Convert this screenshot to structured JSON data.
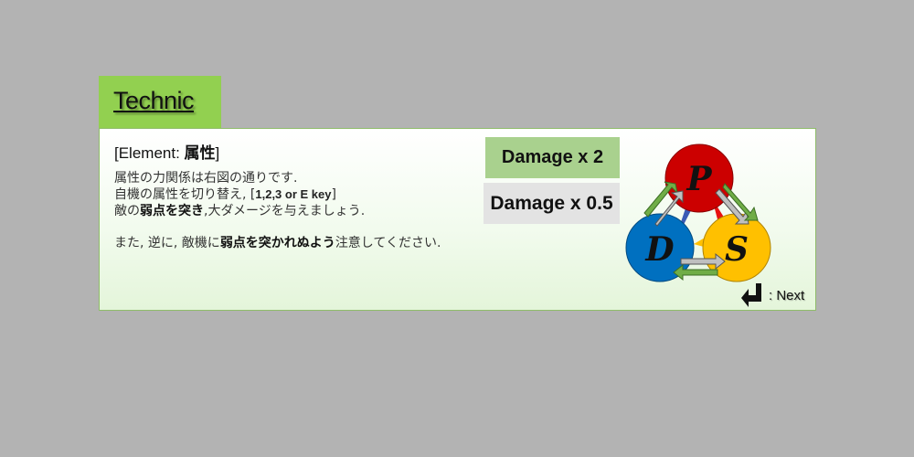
{
  "tab": {
    "title": "Technic"
  },
  "heading": {
    "prefix": "[Element: ",
    "bold": "属性",
    "suffix": "]"
  },
  "lines": {
    "line1": "属性の力関係は右図の通りです.",
    "line2_text": "自機の属性を切り替え, [",
    "line2_keys": "1,2,3 or E key",
    "line2_end": "]",
    "line3_a": "敵の",
    "line3_bold": "弱点を突き",
    "line3_b": ",大ダメージを与えましょう.",
    "line4_a": "また, 逆に, 敵機に",
    "line4_bold": "弱点を突かれぬよう",
    "line4_b": "注意してください."
  },
  "badges": {
    "strong": "Damage x 2",
    "weak": "Damage x 0.5"
  },
  "diagram": {
    "p_label": "P",
    "d_label": "D",
    "s_label": "S",
    "colors": {
      "p": "#cc0000",
      "d": "#0070c0",
      "s": "#ffc000",
      "green_arrow": "#70ad47",
      "gray_arrow": "#bfbfbf"
    }
  },
  "next": {
    "label": ": Next",
    "icon": "enter-key-icon"
  },
  "colors": {
    "tab": "#92d050",
    "background": "#b3b3b3",
    "badge_strong": "#a9d18e",
    "badge_weak": "#e3e3e3"
  }
}
